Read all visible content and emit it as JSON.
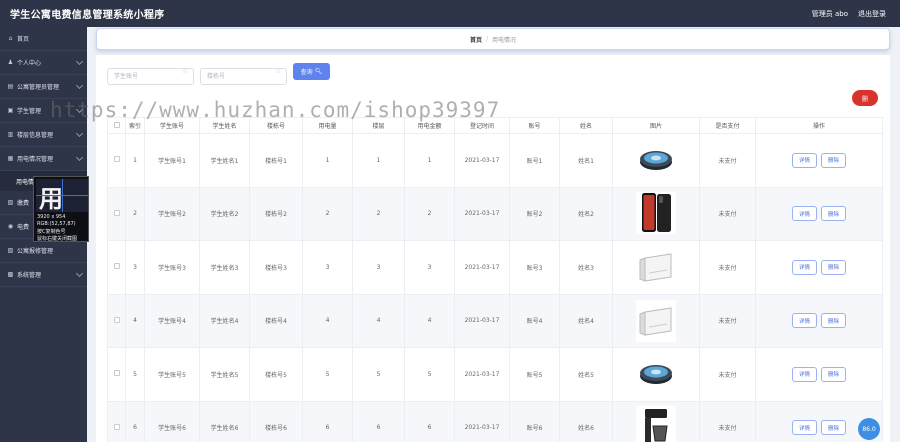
{
  "app": {
    "title": "学生公寓电费信息管理系统小程序"
  },
  "header": {
    "user_label": "管理员 abo",
    "logout_label": "退出登录"
  },
  "sidebar": {
    "items": [
      {
        "label": "首页",
        "icon": "home-icon",
        "has_children": false
      },
      {
        "label": "个人中心",
        "icon": "user-icon",
        "has_children": true
      },
      {
        "label": "公寓管理员管理",
        "icon": "team-icon",
        "has_children": true
      },
      {
        "label": "学生管理",
        "icon": "student-icon",
        "has_children": true
      },
      {
        "label": "楼层信息管理",
        "icon": "building-icon",
        "has_children": true
      },
      {
        "label": "用电情况管理",
        "icon": "chart-icon",
        "has_children": true
      },
      {
        "label": "缴费",
        "icon": "money-icon",
        "has_children": true
      },
      {
        "label": "电费",
        "icon": "bulb-icon",
        "has_children": true
      },
      {
        "label": "公寓报修管理",
        "icon": "tool-icon",
        "has_children": false
      },
      {
        "label": "系统管理",
        "icon": "settings-icon",
        "has_children": true
      }
    ],
    "active_sub_label": "用电情况"
  },
  "breadcrumb": {
    "home": "首页",
    "separator": "/",
    "current": "用电情况"
  },
  "search": {
    "student_no_placeholder": "学生账号",
    "building_no_placeholder": "楼栋号",
    "query_label": "查询"
  },
  "actions": {
    "delete_label": "删"
  },
  "table": {
    "columns": [
      "",
      "索引",
      "学生账号",
      "学生姓名",
      "楼栋号",
      "用电量",
      "楼层",
      "用电金额",
      "登记时间",
      "账号",
      "姓名",
      "图片",
      "是否支付",
      "操作"
    ],
    "rows": [
      {
        "index": "1",
        "student_no": "学生账号1",
        "student_name": "学生姓名1",
        "building_no": "楼栋号1",
        "usage": "1",
        "floor": "1",
        "amount": "1",
        "date": "2021-03-17",
        "account": "账号1",
        "name": "姓名1",
        "image": "robot-vacuum-icon",
        "paid": "未支付"
      },
      {
        "index": "2",
        "student_no": "学生账号2",
        "student_name": "学生姓名2",
        "building_no": "楼栋号2",
        "usage": "2",
        "floor": "2",
        "amount": "2",
        "date": "2021-03-17",
        "account": "账号2",
        "name": "姓名2",
        "image": "smartphone-icon",
        "paid": "未支付"
      },
      {
        "index": "3",
        "student_no": "学生账号3",
        "student_name": "学生姓名3",
        "building_no": "楼栋号3",
        "usage": "3",
        "floor": "3",
        "amount": "3",
        "date": "2021-03-17",
        "account": "账号3",
        "name": "姓名3",
        "image": "air-conditioner-icon",
        "paid": "未支付"
      },
      {
        "index": "4",
        "student_no": "学生账号4",
        "student_name": "学生姓名4",
        "building_no": "楼栋号4",
        "usage": "4",
        "floor": "4",
        "amount": "4",
        "date": "2021-03-17",
        "account": "账号4",
        "name": "姓名4",
        "image": "air-conditioner-icon",
        "paid": "未支付"
      },
      {
        "index": "5",
        "student_no": "学生账号5",
        "student_name": "学生姓名5",
        "building_no": "楼栋号5",
        "usage": "5",
        "floor": "5",
        "amount": "5",
        "date": "2021-03-17",
        "account": "账号5",
        "name": "姓名5",
        "image": "robot-vacuum-icon",
        "paid": "未支付"
      },
      {
        "index": "6",
        "student_no": "学生账号6",
        "student_name": "学生姓名6",
        "building_no": "楼栋号6",
        "usage": "6",
        "floor": "6",
        "amount": "6",
        "date": "2021-03-17",
        "account": "账号6",
        "name": "姓名6",
        "image": "coffee-maker-icon",
        "paid": "未支付"
      }
    ],
    "detail_label": "详情",
    "delete_label": "删除"
  },
  "overlay": {
    "zoom_text": "用情",
    "size_text": "3920 x 954",
    "rgb_text": "RGB:(52,57,87)",
    "copy_hint": "按C复制色号",
    "close_hint": "鼠标右键关闭截图"
  },
  "watermark": {
    "text": "https://www.huzhan.com/ishop39397"
  },
  "float_badge": {
    "label": "86.0"
  },
  "colors": {
    "sidebar_bg": "#2e3548",
    "primary": "#5e83ee",
    "danger": "#d9342b",
    "row_alt": "#f5f7fb"
  }
}
